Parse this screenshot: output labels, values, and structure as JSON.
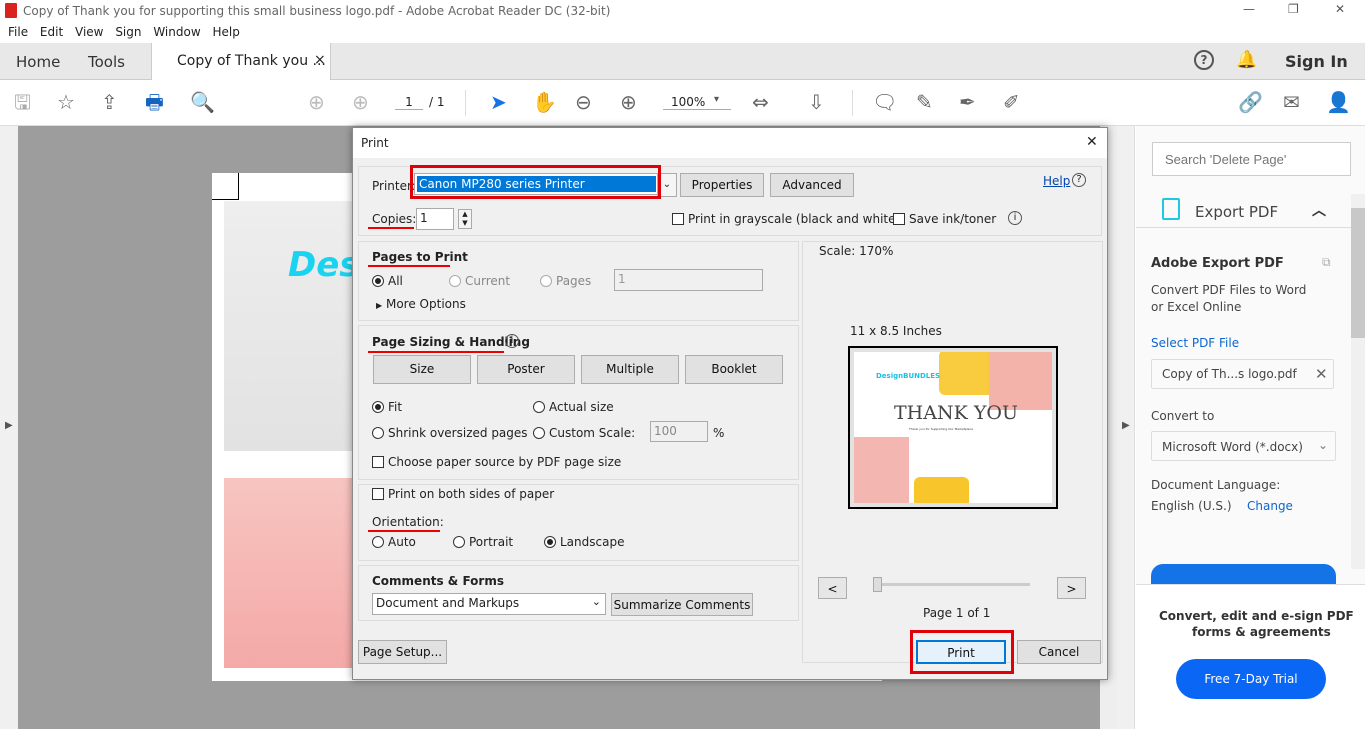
{
  "window": {
    "title": "Copy of Thank you for supporting this small business logo.pdf - Adobe Acrobat Reader DC (32-bit)",
    "minimize": "—",
    "restore": "❐",
    "close": "✕"
  },
  "menu": [
    "File",
    "Edit",
    "View",
    "Sign",
    "Window",
    "Help"
  ],
  "tabs": {
    "home": "Home",
    "tools": "Tools",
    "document": "Copy of Thank you ...",
    "close": "×",
    "sign_in": "Sign In"
  },
  "toolbar": {
    "page_current": "1",
    "page_total": "/ 1",
    "zoom": "100%"
  },
  "page_preview": {
    "logo_text": "Desi"
  },
  "print_dialog": {
    "title": "Print",
    "close": "✕",
    "printer_label": "Printer:",
    "printer_value": "Canon MP280 series Printer",
    "properties": "Properties",
    "advanced": "Advanced",
    "help": "Help",
    "copies_label": "Copies:",
    "copies_value": "1",
    "grayscale": "Print in grayscale (black and white)",
    "save_ink": "Save ink/toner",
    "pages_heading": "Pages to Print",
    "all": "All",
    "current": "Current",
    "pages": "Pages",
    "pages_value": "1",
    "more_options": "More Options",
    "sizing_heading": "Page Sizing & Handling",
    "size": "Size",
    "poster": "Poster",
    "multiple": "Multiple",
    "booklet": "Booklet",
    "fit": "Fit",
    "actual_size": "Actual size",
    "shrink": "Shrink oversized pages",
    "custom_scale": "Custom Scale:",
    "custom_scale_value": "100",
    "percent": "%",
    "paper_source": "Choose paper source by PDF page size",
    "both_sides": "Print on both sides of paper",
    "orientation_label": "Orientation:",
    "auto": "Auto",
    "portrait": "Portrait",
    "landscape": "Landscape",
    "comments_heading": "Comments & Forms",
    "comments_value": "Document and Markups",
    "summarize": "Summarize Comments",
    "scale": "Scale: 170%",
    "paper_size": "11 x 8.5 Inches",
    "prev": "<",
    "next": ">",
    "page_of": "Page 1 of 1",
    "thumb_logo": "DesignBUNDLES",
    "thumb_title": "THANK YOU",
    "thumb_sub": "Thank you for Supporting Our Marketplace",
    "page_setup": "Page Setup...",
    "print": "Print",
    "cancel": "Cancel"
  },
  "right_panel": {
    "search_placeholder": "Search 'Delete Page'",
    "export_title": "Export PDF",
    "heading": "Adobe Export PDF",
    "desc1": "Convert PDF Files to Word",
    "desc2": "or Excel Online",
    "select_file": "Select PDF File",
    "file_name": "Copy of Th...s logo.pdf",
    "convert_to": "Convert to",
    "format": "Microsoft Word (*.docx)",
    "doc_lang": "Document Language:",
    "lang": "English (U.S.)",
    "change": "Change",
    "promo1": "Convert, edit and e-sign PDF",
    "promo2": "forms & agreements",
    "trial": "Free 7-Day Trial"
  },
  "colors": {
    "accent": "#0d6efd",
    "highlight": "#0078d7",
    "annotation": "#e0000a",
    "trial_button": "#0a66f5"
  }
}
